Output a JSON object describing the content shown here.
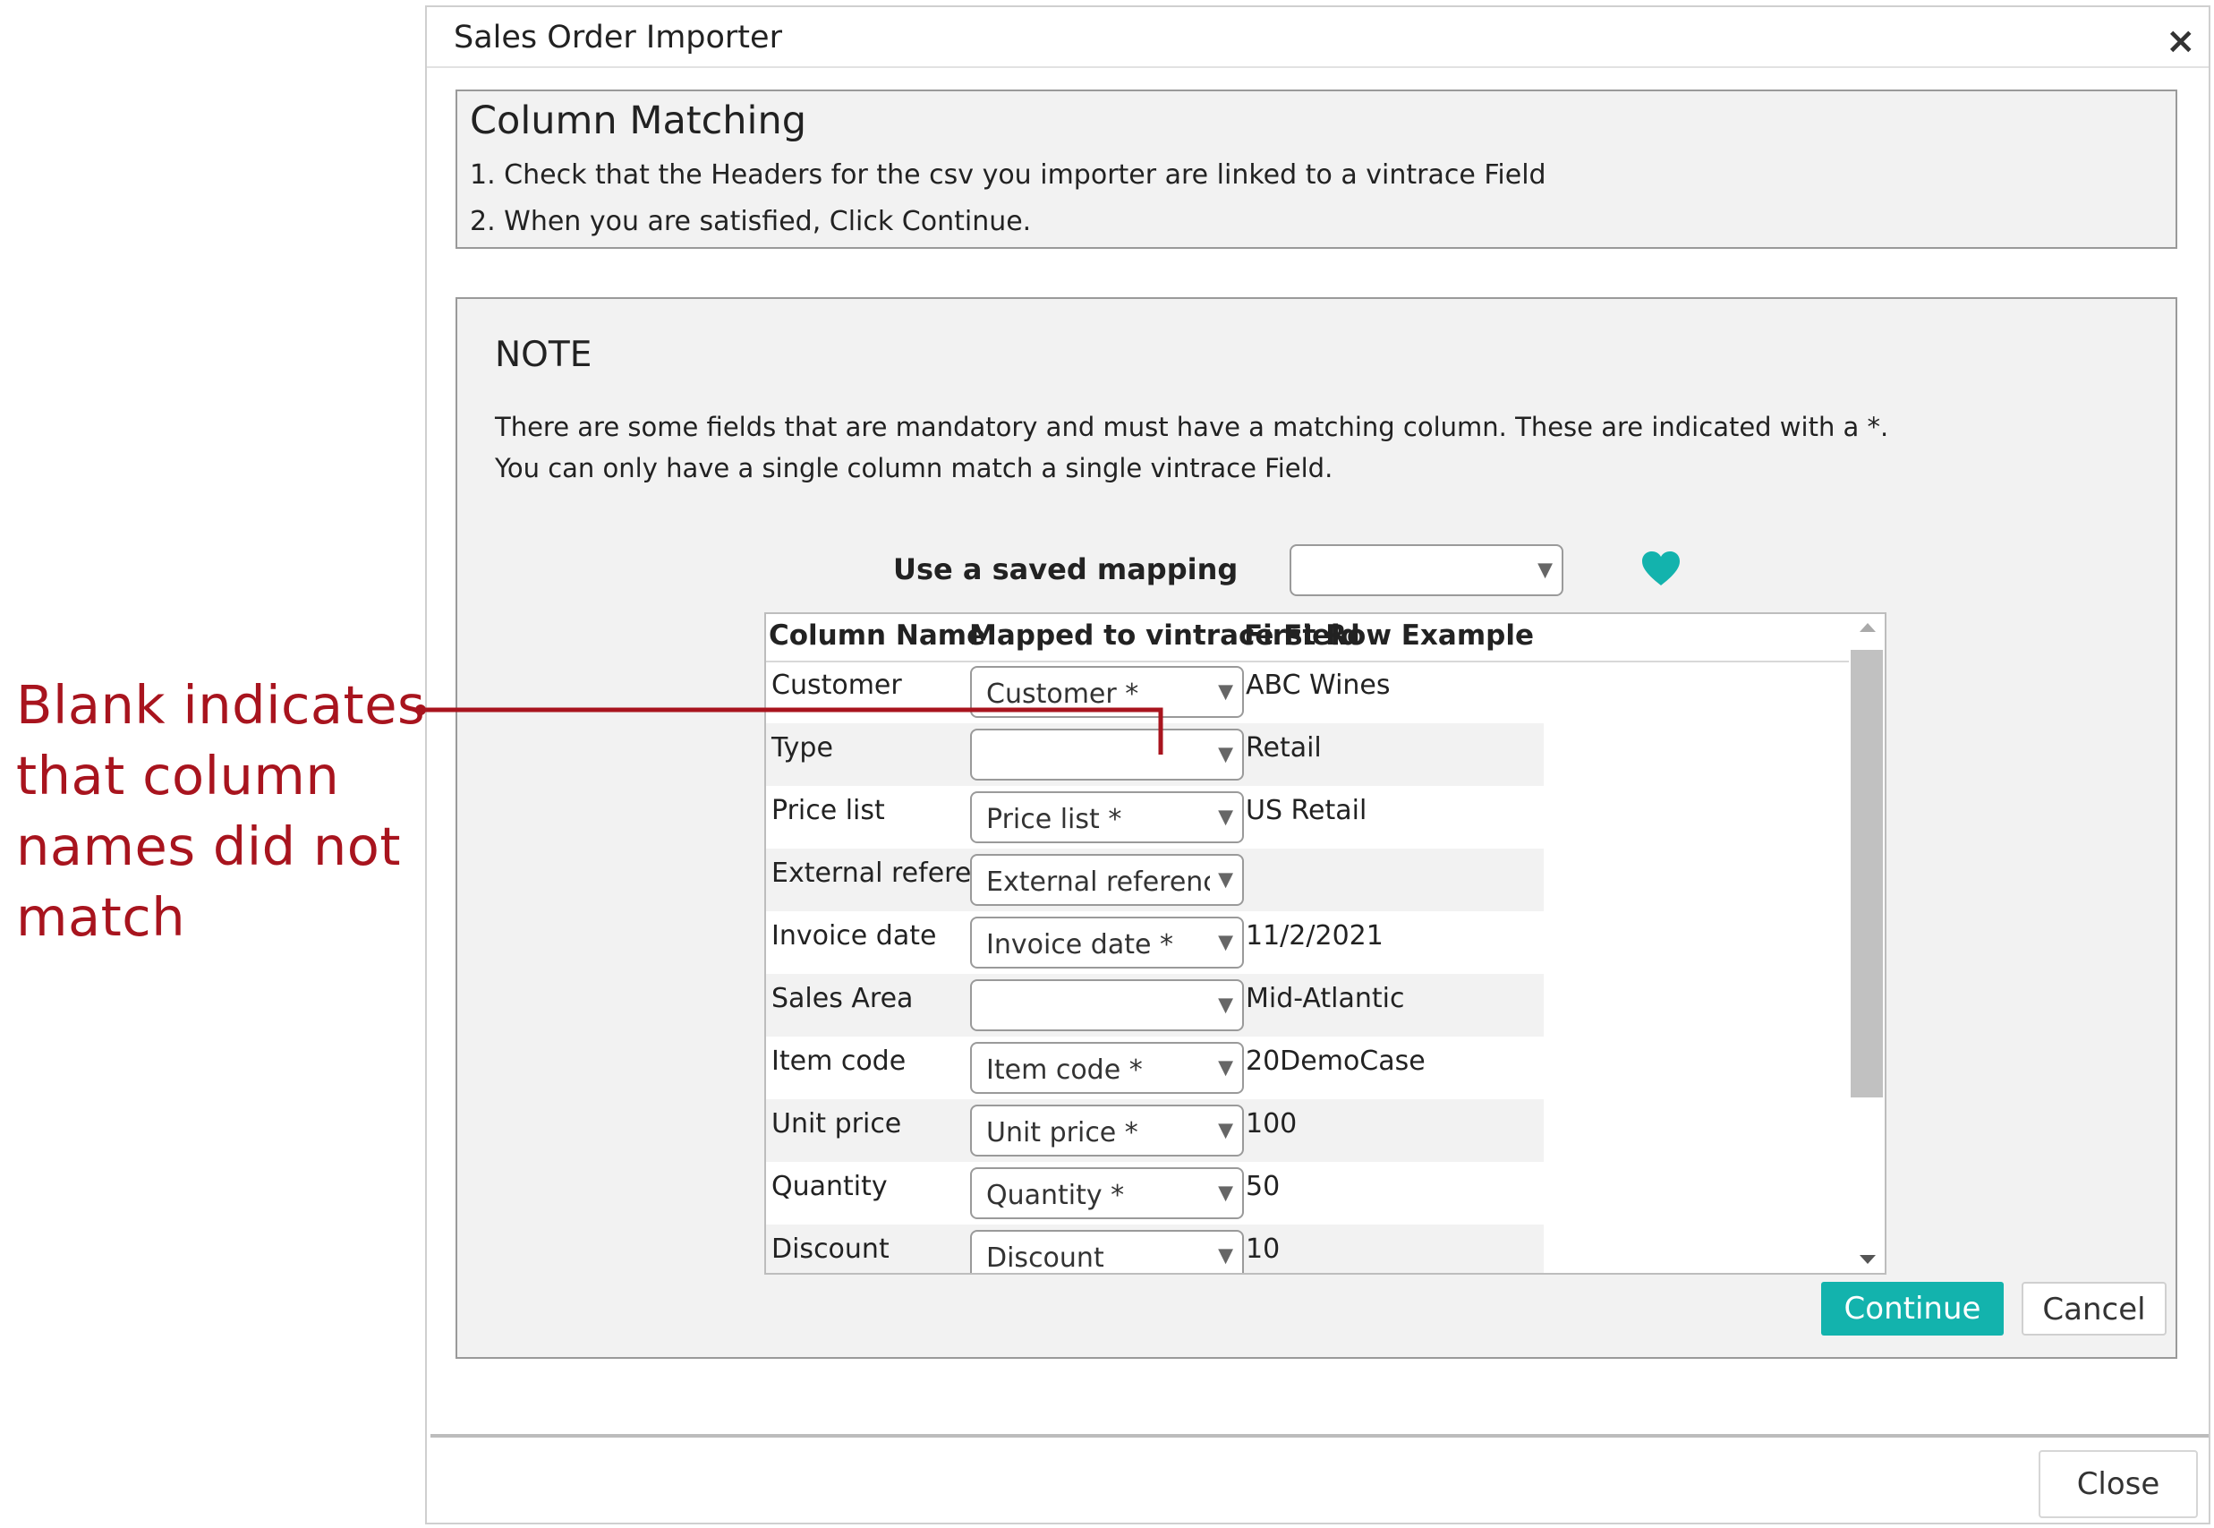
{
  "annotation": {
    "lines": [
      "Blank indicates",
      "that column",
      "names did not",
      "match"
    ],
    "color": "#a8141e"
  },
  "dialog": {
    "title": "Sales Order Importer",
    "close_icon": "×"
  },
  "instructions": {
    "heading": "Column Matching",
    "line1": "1. Check that the Headers for the csv you importer are linked to a vintrace Field",
    "line2": "2. When you are satisfied, Click Continue."
  },
  "note": {
    "heading": "NOTE",
    "line1": "There are some fields that are mandatory and must have a matching column. These are indicated with a *.",
    "line2": "You can only have a single column match a single vintrace Field."
  },
  "saved_mapping": {
    "label": "Use a saved mapping",
    "value": "",
    "heart_color": "#13b3ad"
  },
  "grid": {
    "headers": [
      "Column Name",
      "Mapped to vintrace Field",
      "First Row Example"
    ],
    "rows": [
      {
        "column": "Customer",
        "mapped": "Customer *",
        "example": "ABC Wines"
      },
      {
        "column": "Type",
        "mapped": "",
        "example": "Retail"
      },
      {
        "column": "Price list",
        "mapped": "Price list *",
        "example": "US Retail"
      },
      {
        "column": "External reference",
        "mapped": "External referenc",
        "example": ""
      },
      {
        "column": "Invoice date",
        "mapped": "Invoice date *",
        "example": "11/2/2021"
      },
      {
        "column": "Sales Area",
        "mapped": "",
        "example": "Mid-Atlantic"
      },
      {
        "column": "Item code",
        "mapped": "Item code *",
        "example": "20DemoCase"
      },
      {
        "column": "Unit price",
        "mapped": "Unit price *",
        "example": "100"
      },
      {
        "column": "Quantity",
        "mapped": "Quantity *",
        "example": "50"
      },
      {
        "column": "Discount",
        "mapped": "Discount",
        "example": "10"
      }
    ]
  },
  "buttons": {
    "continue": "Continue",
    "cancel": "Cancel",
    "close": "Close"
  },
  "colors": {
    "accent": "#13b3ad",
    "panel_bg": "#f2f2f2"
  }
}
